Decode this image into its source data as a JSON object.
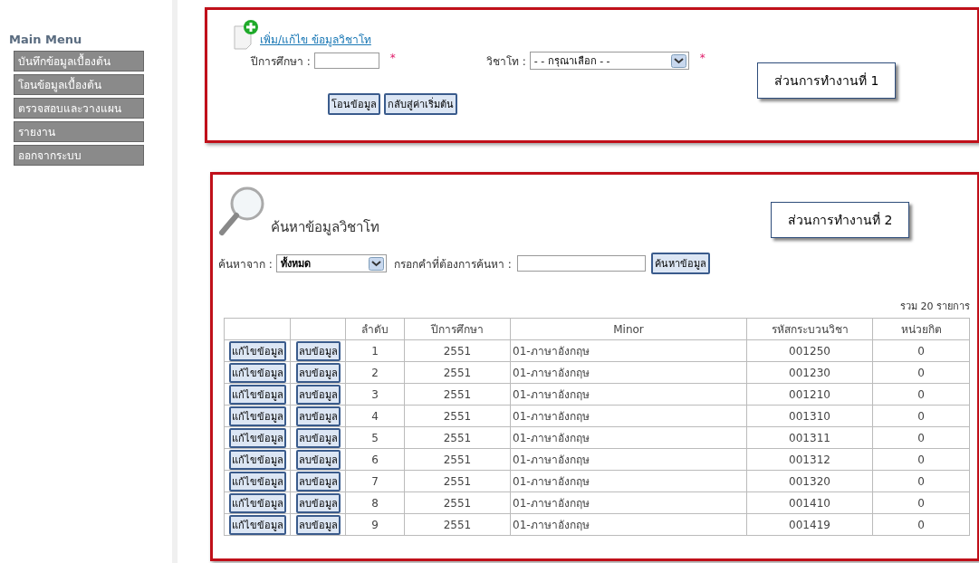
{
  "sidebar": {
    "title": "Main Menu",
    "items": [
      {
        "label": "บันทึกข้อมูลเบื้องต้น"
      },
      {
        "label": "โอนข้อมูลเบื้องต้น"
      },
      {
        "label": "ตรวจสอบและวางแผน"
      },
      {
        "label": "รายงาน"
      },
      {
        "label": "ออกจากระบบ"
      }
    ]
  },
  "section1": {
    "link": "เพิ่ม/แก้ไข ข้อมูลวิชาโท",
    "year_label": "ปีการศึกษา :",
    "required_mark": "*",
    "minor_label": "วิชาโท :",
    "minor_value": "- - กรุณาเลือก - -",
    "minor_required_mark": "*",
    "buttons": [
      "โอนข้อมูล",
      "กลับสู่ค่าเริ่มต้น"
    ],
    "callout": "ส่วนการทำงานที่ 1"
  },
  "section2": {
    "title": "ค้นหาข้อมูลวิชาโท",
    "callout": "ส่วนการทำงานที่ 2",
    "search_from_label": "ค้นหาจาก :",
    "search_from_value": "ทั้งหมด",
    "keyword_label": "กรอกคำที่ต้องการค้นหา :",
    "search_button": "ค้นหาข้อมูล",
    "total": "รวม 20 รายการ",
    "table": {
      "columns": [
        "",
        "",
        "ลำดับ",
        "ปีการศึกษา",
        "Minor",
        "รหัสกระบวนวิชา",
        "หน่วยกิต"
      ],
      "rows": [
        [
          "แก้ไขข้อมูล",
          "ลบข้อมูล",
          "1",
          "2551",
          "01-ภาษาอังกฤษ",
          "001250",
          "0"
        ],
        [
          "แก้ไขข้อมูล",
          "ลบข้อมูล",
          "2",
          "2551",
          "01-ภาษาอังกฤษ",
          "001230",
          "0"
        ],
        [
          "แก้ไขข้อมูล",
          "ลบข้อมูล",
          "3",
          "2551",
          "01-ภาษาอังกฤษ",
          "001210",
          "0"
        ],
        [
          "แก้ไขข้อมูล",
          "ลบข้อมูล",
          "4",
          "2551",
          "01-ภาษาอังกฤษ",
          "001310",
          "0"
        ],
        [
          "แก้ไขข้อมูล",
          "ลบข้อมูล",
          "5",
          "2551",
          "01-ภาษาอังกฤษ",
          "001311",
          "0"
        ],
        [
          "แก้ไขข้อมูล",
          "ลบข้อมูล",
          "6",
          "2551",
          "01-ภาษาอังกฤษ",
          "001312",
          "0"
        ],
        [
          "แก้ไขข้อมูล",
          "ลบข้อมูล",
          "7",
          "2551",
          "01-ภาษาอังกฤษ",
          "001320",
          "0"
        ],
        [
          "แก้ไขข้อมูล",
          "ลบข้อมูล",
          "8",
          "2551",
          "01-ภาษาอังกฤษ",
          "001410",
          "0"
        ],
        [
          "แก้ไขข้อมูล",
          "ลบข้อมูล",
          "9",
          "2551",
          "01-ภาษาอังกฤษ",
          "001419",
          "0"
        ]
      ]
    }
  }
}
